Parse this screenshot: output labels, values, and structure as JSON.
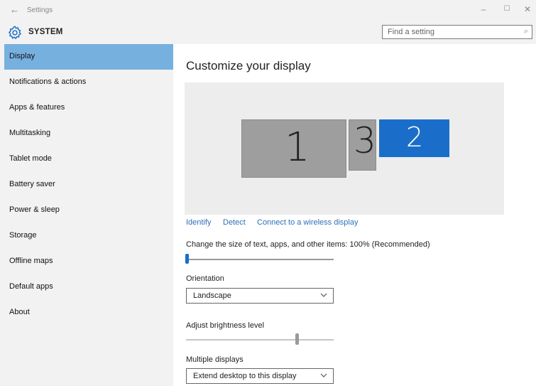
{
  "window": {
    "title": "Settings"
  },
  "header": {
    "section": "SYSTEM",
    "search_placeholder": "Find a setting"
  },
  "sidebar": {
    "items": [
      {
        "label": "Display",
        "selected": true
      },
      {
        "label": "Notifications & actions"
      },
      {
        "label": "Apps & features"
      },
      {
        "label": "Multitasking"
      },
      {
        "label": "Tablet mode"
      },
      {
        "label": "Battery saver"
      },
      {
        "label": "Power & sleep"
      },
      {
        "label": "Storage"
      },
      {
        "label": "Offline maps"
      },
      {
        "label": "Default apps"
      },
      {
        "label": "About"
      }
    ]
  },
  "main": {
    "title": "Customize your display",
    "monitors": [
      {
        "number": "1",
        "selected": false
      },
      {
        "number": "3",
        "selected": false
      },
      {
        "number": "2",
        "selected": true
      }
    ],
    "links": {
      "identify": "Identify",
      "detect": "Detect",
      "connect": "Connect to a wireless display"
    },
    "scale_label": "Change the size of text, apps, and other items: 100% (Recommended)",
    "orientation": {
      "label": "Orientation",
      "value": "Landscape"
    },
    "brightness": {
      "label": "Adjust brightness level"
    },
    "multiple_displays": {
      "label": "Multiple displays",
      "value": "Extend desktop to this display"
    }
  },
  "colors": {
    "accent": "#1a6ec9",
    "selected_nav": "#76b0df",
    "link": "#2d6fb7",
    "sidebar_bg": "#f2f2f2"
  },
  "icons": {
    "back": "back-arrow-icon",
    "settings": "gear-icon",
    "search": "search-icon",
    "dropdown": "chevron-down-icon"
  }
}
